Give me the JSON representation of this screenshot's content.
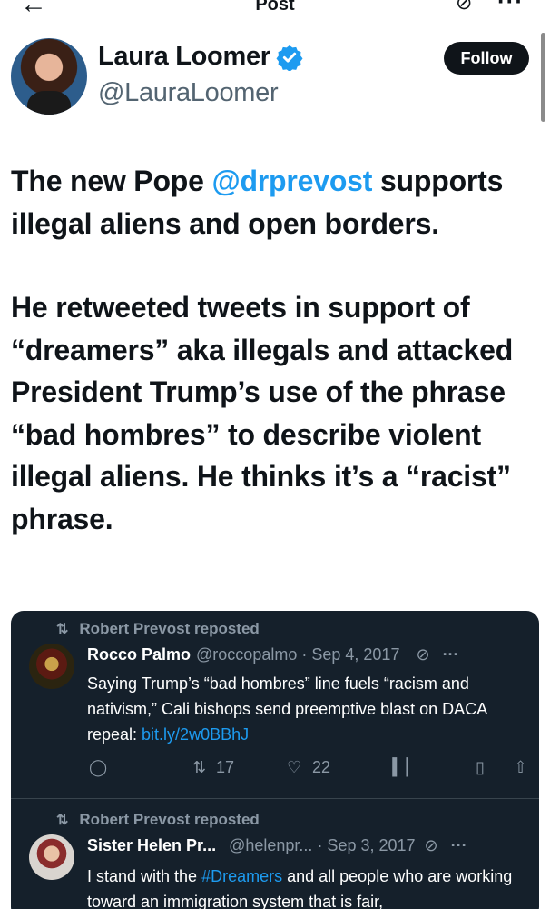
{
  "topbar": {
    "back_icon": "arrow-left-icon",
    "title": "Post",
    "grok_icon": "grok-icon",
    "more_icon": "more-icon"
  },
  "author": {
    "name": "Laura Loomer",
    "handle": "@LauraLoomer",
    "verified": true,
    "follow_label": "Follow"
  },
  "post": {
    "p1_before": "The new Pope ",
    "p1_mention": "@drprevost",
    "p1_after": " supports illegal aliens and open borders.",
    "p2": "He retweeted tweets in support of “dreamers” aka illegals and attacked President Trump’s use of the phrase “bad hombres” to describe violent illegal aliens. He thinks it’s a “racist” phrase."
  },
  "embedded": [
    {
      "repost_label": "Robert Prevost reposted",
      "name": "Rocco Palmo",
      "handle": "@roccopalmo",
      "date": "· Sep 4, 2017",
      "text": "Saying Trump’s “bad hombres” line fuels “racism and nativism,” Cali bishops send preemptive blast on DACA repeal: ",
      "link": "bit.ly/2w0BBhJ",
      "retweets": "17",
      "likes": "22"
    },
    {
      "repost_label": "Robert Prevost reposted",
      "name": "Sister Helen Pr...",
      "handle": "@helenpr...",
      "date": "· Sep 3, 2017",
      "text_before": "I stand with the ",
      "hashtag": "#Dreamers",
      "text_after": " and all people who are working toward an immigration system that is fair,"
    }
  ],
  "colors": {
    "accent": "#1d9bf0",
    "text": "#0f1419",
    "secondary": "#536471",
    "embed_bg": "#15202b"
  }
}
